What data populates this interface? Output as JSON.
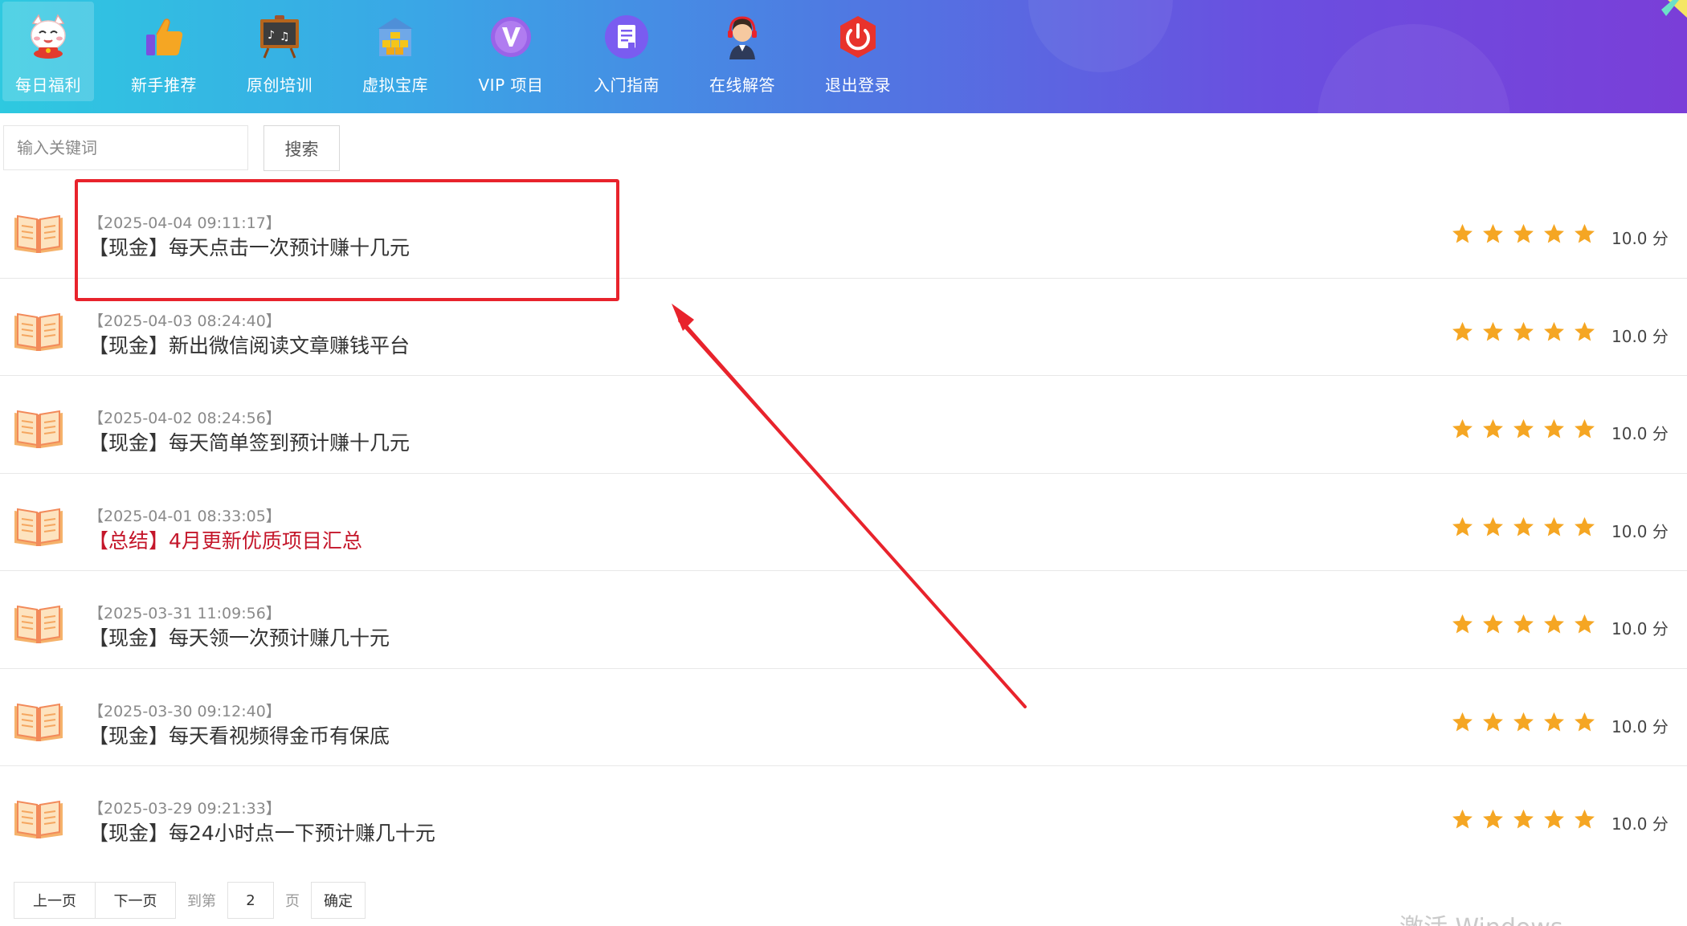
{
  "nav": {
    "items": [
      {
        "label": "每日福利",
        "icon": "lucky-cat-icon",
        "active": true
      },
      {
        "label": "新手推荐",
        "icon": "thumbs-up-icon",
        "active": false
      },
      {
        "label": "原创培训",
        "icon": "blackboard-icon",
        "active": false
      },
      {
        "label": "虚拟宝库",
        "icon": "treasure-store-icon",
        "active": false
      },
      {
        "label": "VIP 项目",
        "icon": "vip-badge-icon",
        "active": false
      },
      {
        "label": "入门指南",
        "icon": "document-icon",
        "active": false
      },
      {
        "label": "在线解答",
        "icon": "customer-service-icon",
        "active": false
      },
      {
        "label": "退出登录",
        "icon": "power-icon",
        "active": false
      }
    ]
  },
  "search": {
    "placeholder": "输入关键词",
    "button_label": "搜索"
  },
  "articles": [
    {
      "date": "【2025-04-04 09:11:17】",
      "title": "【现金】每天点击一次预计赚十几元",
      "highlight": false,
      "stars": 5,
      "score": "10.0 分"
    },
    {
      "date": "【2025-04-03 08:24:40】",
      "title": "【现金】新出微信阅读文章赚钱平台",
      "highlight": false,
      "stars": 5,
      "score": "10.0 分"
    },
    {
      "date": "【2025-04-02 08:24:56】",
      "title": "【现金】每天简单签到预计赚十几元",
      "highlight": false,
      "stars": 5,
      "score": "10.0 分"
    },
    {
      "date": "【2025-04-01 08:33:05】",
      "title": "【总结】4月更新优质项目汇总",
      "highlight": true,
      "stars": 5,
      "score": "10.0 分"
    },
    {
      "date": "【2025-03-31 11:09:56】",
      "title": "【现金】每天领一次预计赚几十元",
      "highlight": false,
      "stars": 5,
      "score": "10.0 分"
    },
    {
      "date": "【2025-03-30 09:12:40】",
      "title": "【现金】每天看视频得金币有保底",
      "highlight": false,
      "stars": 5,
      "score": "10.0 分"
    },
    {
      "date": "【2025-03-29 09:21:33】",
      "title": "【现金】每24小时点一下预计赚几十元",
      "highlight": false,
      "stars": 5,
      "score": "10.0 分"
    }
  ],
  "pagination": {
    "prev_label": "上一页",
    "next_label": "下一页",
    "goto_label": "到第",
    "page_value": "2",
    "page_suffix": "页",
    "confirm_label": "确定"
  },
  "watermark": "激活 Windows",
  "colors": {
    "header_gradient_start": "#2ec9e0",
    "header_gradient_end": "#7a3ed8",
    "star": "#f5a623",
    "highlight_title": "#c4162a",
    "annotation_red": "#e8232c"
  }
}
